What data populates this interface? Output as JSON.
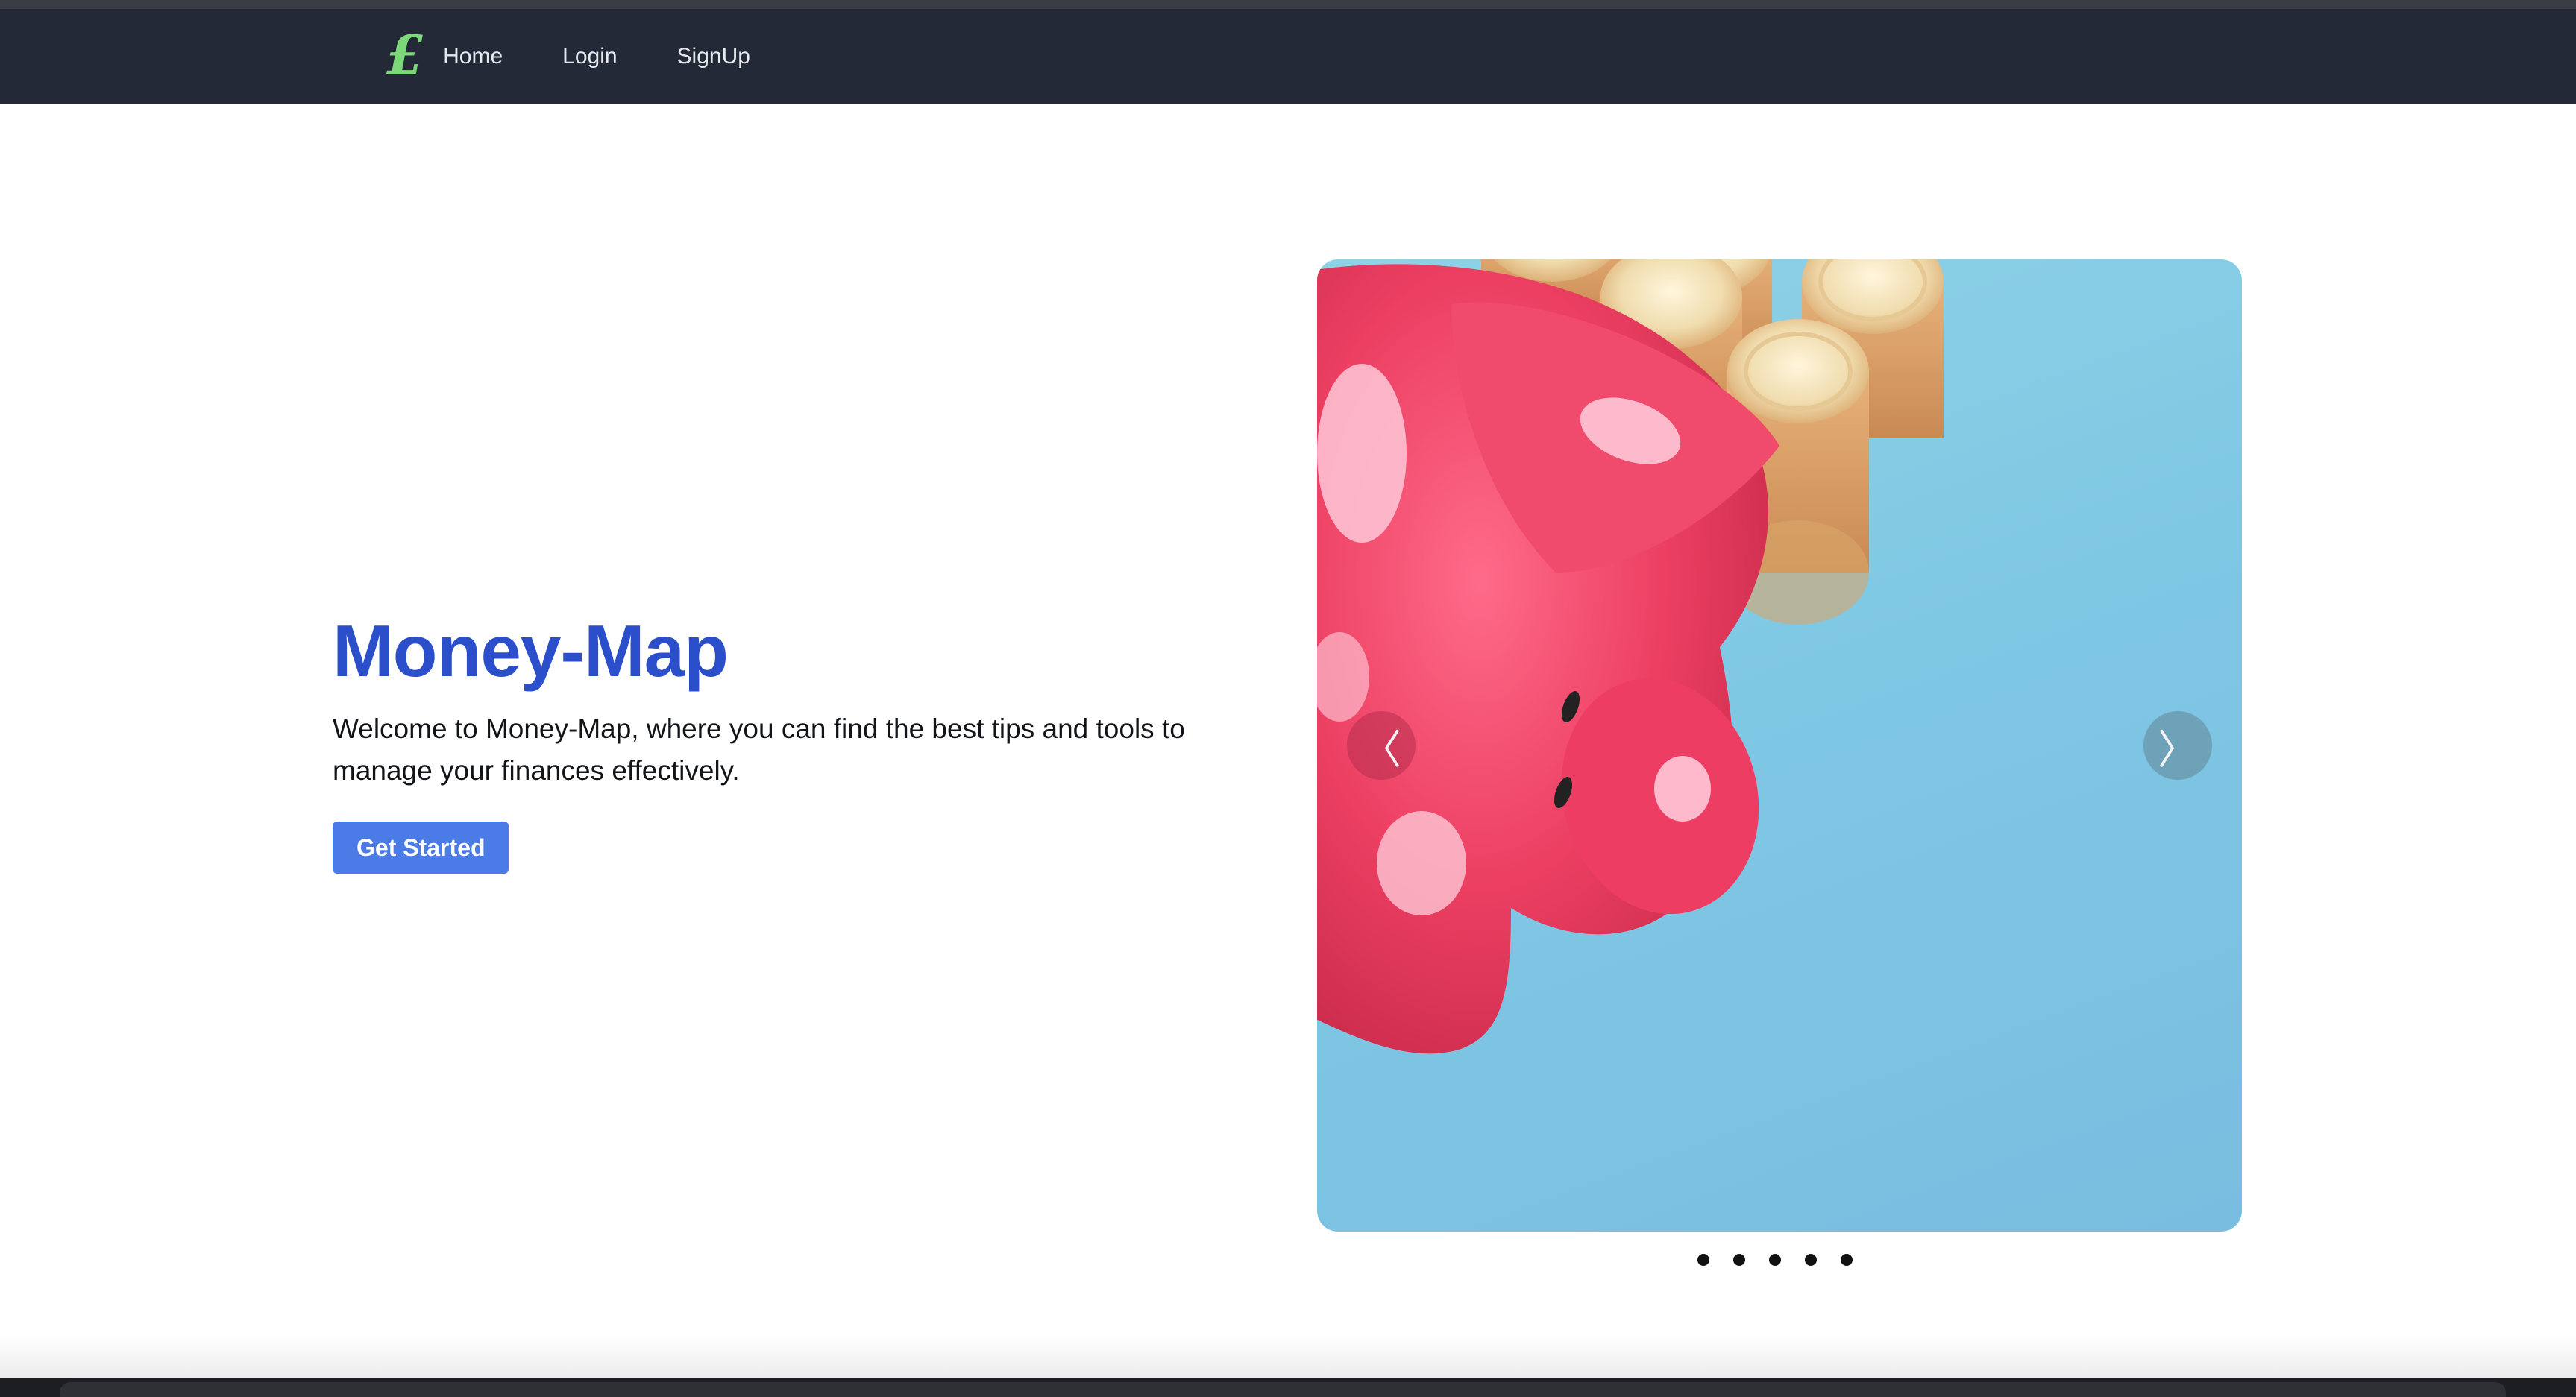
{
  "nav": {
    "logo_symbol": "£",
    "links": [
      "Home",
      "Login",
      "SignUp"
    ]
  },
  "hero": {
    "title": "Money-Map",
    "description": "Welcome to Money-Map, where you can find the best tips and tools to manage your finances effectively.",
    "cta_label": "Get Started"
  },
  "carousel": {
    "prev_symbol": "〈",
    "next_symbol": "〉",
    "slide_count": 5,
    "image_subject": "pink piggy bank with stacks of gold coins"
  },
  "colors": {
    "nav_bg": "#232937",
    "logo": "#7dd87a",
    "title": "#2b4ecb",
    "button": "#4a7be6",
    "carousel_bg": "#86cbe4"
  }
}
